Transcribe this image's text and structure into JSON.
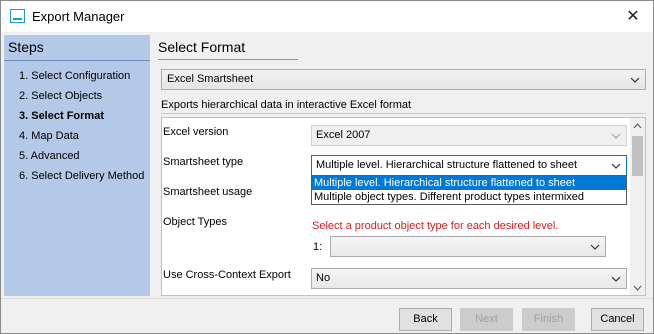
{
  "window": {
    "title": "Export Manager",
    "close_symbol": "✕"
  },
  "sidebar": {
    "title": "Steps",
    "steps": [
      {
        "label": "1. Select Configuration",
        "active": false
      },
      {
        "label": "2. Select Objects",
        "active": false
      },
      {
        "label": "3. Select Format",
        "active": true
      },
      {
        "label": "4. Map Data",
        "active": false
      },
      {
        "label": "5. Advanced",
        "active": false
      },
      {
        "label": "6. Select Delivery Method",
        "active": false
      }
    ]
  },
  "main": {
    "title": "Select Format",
    "format_select": {
      "value": "Excel Smartsheet"
    },
    "description": "Exports hierarchical data in interactive Excel format",
    "fields": {
      "excel_version": {
        "label": "Excel version",
        "value": "Excel 2007",
        "enabled": false
      },
      "smartsheet_type": {
        "label": "Smartsheet type",
        "value": "Multiple level. Hierarchical structure flattened to sheet",
        "options": [
          "Multiple level. Hierarchical structure flattened to sheet",
          "Multiple object types. Different product types intermixed"
        ],
        "selected_index": 0,
        "expanded": true
      },
      "smartsheet_usage": {
        "label": "Smartsheet usage"
      },
      "object_types": {
        "label": "Object Types",
        "hint": "Select a product object type for each desired level.",
        "level_label": "1:",
        "level_value": ""
      },
      "cross_context": {
        "label": "Use Cross-Context Export",
        "value": "No"
      }
    }
  },
  "footer": {
    "back": {
      "label": "Back",
      "enabled": true
    },
    "next": {
      "label": "Next",
      "enabled": false
    },
    "finish": {
      "label": "Finish",
      "enabled": false
    },
    "cancel": {
      "label": "Cancel",
      "enabled": true
    }
  },
  "colors": {
    "sidebar_bg": "#b3c9e7",
    "accent": "#0078d7",
    "hint_red": "#e8151b",
    "title_icon": "#1c9fc1"
  }
}
